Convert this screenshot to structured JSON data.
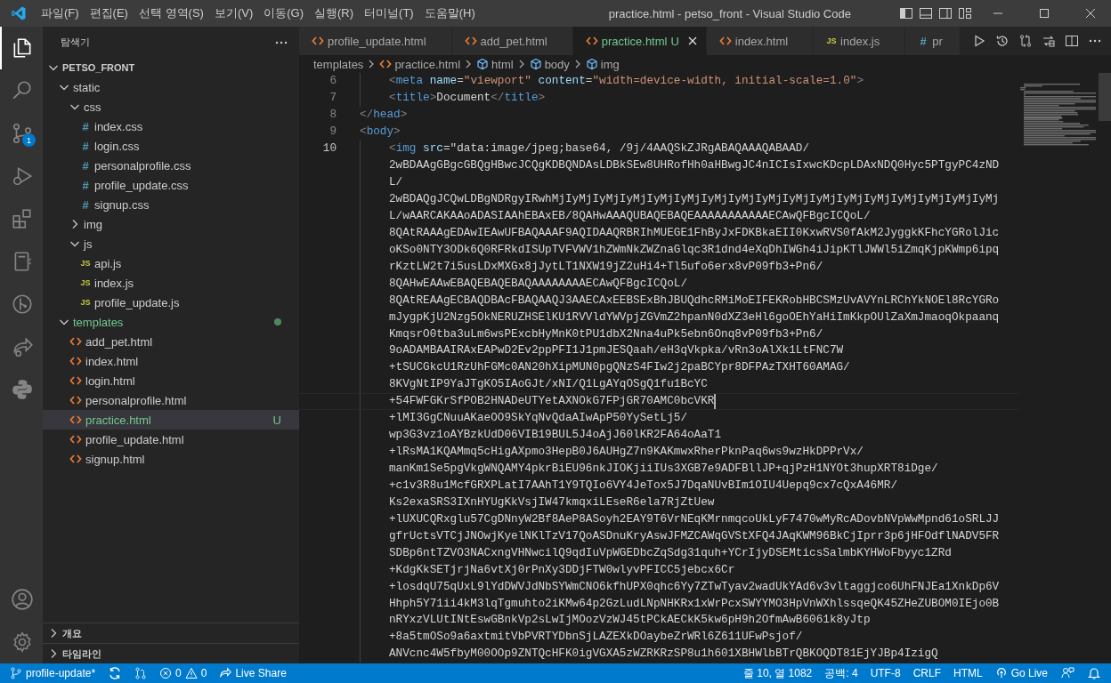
{
  "window": {
    "title": "practice.html - petso_front - Visual Studio Code"
  },
  "menu": [
    "파일(F)",
    "편집(E)",
    "선택 영역(S)",
    "보기(V)",
    "이동(G)",
    "실행(R)",
    "터미널(T)",
    "도움말(H)"
  ],
  "activity_bar": {
    "source_control_badge": "1"
  },
  "sidebar": {
    "title": "탐색기",
    "tree": {
      "label": "PETSO_FRONT",
      "kind": "root",
      "expanded": true,
      "selected": false,
      "untracked": false,
      "children": [
        {
          "label": "static",
          "kind": "folder",
          "expanded": true,
          "selected": false,
          "untracked": false,
          "children": [
            {
              "label": "css",
              "kind": "folder",
              "expanded": true,
              "selected": false,
              "untracked": false,
              "children": [
                {
                  "label": "index.css",
                  "kind": "css",
                  "icon": "#",
                  "selected": false,
                  "untracked": false
                },
                {
                  "label": "login.css",
                  "kind": "css",
                  "icon": "#",
                  "selected": false,
                  "untracked": false
                },
                {
                  "label": "personalprofile.css",
                  "kind": "css",
                  "icon": "#",
                  "selected": false,
                  "untracked": false
                },
                {
                  "label": "profile_update.css",
                  "kind": "css",
                  "icon": "#",
                  "selected": false,
                  "untracked": false
                },
                {
                  "label": "signup.css",
                  "kind": "css",
                  "icon": "#",
                  "selected": false,
                  "untracked": false
                }
              ]
            },
            {
              "label": "img",
              "kind": "folder",
              "expanded": false,
              "selected": false,
              "untracked": false
            },
            {
              "label": "js",
              "kind": "folder",
              "expanded": true,
              "selected": false,
              "untracked": false,
              "children": [
                {
                  "label": "api.js",
                  "kind": "js",
                  "icon": "JS",
                  "selected": false,
                  "untracked": false
                },
                {
                  "label": "index.js",
                  "kind": "js",
                  "icon": "JS",
                  "selected": false,
                  "untracked": false
                },
                {
                  "label": "profile_update.js",
                  "kind": "js",
                  "icon": "JS",
                  "selected": false,
                  "untracked": false
                }
              ]
            }
          ]
        },
        {
          "label": "templates",
          "kind": "folder",
          "expanded": true,
          "selected": false,
          "untracked": true,
          "children": [
            {
              "label": "add_pet.html",
              "kind": "html",
              "selected": false,
              "untracked": false
            },
            {
              "label": "index.html",
              "kind": "html",
              "selected": false,
              "untracked": false
            },
            {
              "label": "login.html",
              "kind": "html",
              "selected": false,
              "untracked": false
            },
            {
              "label": "personalprofile.html",
              "kind": "html",
              "selected": false,
              "untracked": false
            },
            {
              "label": "practice.html",
              "kind": "html",
              "selected": true,
              "untracked": true,
              "status": "U"
            },
            {
              "label": "profile_update.html",
              "kind": "html",
              "selected": false,
              "untracked": false
            },
            {
              "label": "signup.html",
              "kind": "html",
              "selected": false,
              "untracked": false
            }
          ]
        }
      ]
    }
  },
  "sections": [
    {
      "label": "개요",
      "expanded": false
    },
    {
      "label": "타임라인",
      "expanded": false
    }
  ],
  "tabs": [
    {
      "label": "profile_update.html",
      "kind": "html",
      "selected": false,
      "untracked": false
    },
    {
      "label": "add_pet.html",
      "kind": "html",
      "selected": false,
      "untracked": false
    },
    {
      "label": "practice.html",
      "kind": "html",
      "selected": true,
      "untracked": true,
      "status": "U"
    },
    {
      "label": "index.html",
      "kind": "html",
      "selected": false,
      "untracked": false
    },
    {
      "label": "index.js",
      "kind": "js",
      "icon": "JS",
      "selected": false,
      "untracked": false
    },
    {
      "label": "pr",
      "kind": "css",
      "icon": "#",
      "selected": false,
      "untracked": false
    }
  ],
  "breadcrumbs": [
    {
      "label": "templates",
      "kind": "folder"
    },
    {
      "label": "practice.html",
      "kind": "html"
    },
    {
      "label": "html",
      "kind": "element"
    },
    {
      "label": "body",
      "kind": "element"
    },
    {
      "label": "img",
      "kind": "element"
    }
  ],
  "editor": {
    "rows": [
      {
        "kind": "nested",
        "number": "6",
        "current": false,
        "tokens": [
          {
            "kind": "bracket",
            "text": "<"
          },
          {
            "kind": "tag",
            "text": "meta"
          },
          {
            "kind": "attr",
            "text": " name"
          },
          {
            "kind": "text",
            "text": "="
          },
          {
            "kind": "string",
            "text": "\"viewport\""
          },
          {
            "kind": "attr",
            "text": " content"
          },
          {
            "kind": "text",
            "text": "="
          },
          {
            "kind": "string",
            "text": "\"width=device-width, initial-scale=1.0\""
          },
          {
            "kind": "bracket",
            "text": ">"
          }
        ]
      },
      {
        "kind": "nested",
        "number": "7",
        "current": false,
        "tokens": [
          {
            "kind": "bracket",
            "text": "<"
          },
          {
            "kind": "tag",
            "text": "title"
          },
          {
            "kind": "bracket",
            "text": ">"
          },
          {
            "kind": "text",
            "text": "Document"
          },
          {
            "kind": "bracket",
            "text": "</"
          },
          {
            "kind": "tag",
            "text": "title"
          },
          {
            "kind": "bracket",
            "text": ">"
          }
        ]
      },
      {
        "kind": "top",
        "number": "8",
        "current": false,
        "tokens": [
          {
            "kind": "bracket",
            "text": "</"
          },
          {
            "kind": "tag",
            "text": "head"
          },
          {
            "kind": "bracket",
            "text": ">"
          }
        ]
      },
      {
        "kind": "top",
        "number": "9",
        "current": false,
        "tokens": [
          {
            "kind": "bracket",
            "text": "<"
          },
          {
            "kind": "tag",
            "text": "body"
          },
          {
            "kind": "bracket",
            "text": ">"
          }
        ]
      },
      {
        "kind": "nested",
        "number": "10",
        "current": false,
        "tokens": [
          {
            "kind": "bracket",
            "text": "<"
          },
          {
            "kind": "tag",
            "text": "img"
          },
          {
            "kind": "attr",
            "text": " src"
          },
          {
            "kind": "text",
            "text": "=\"data:image/jpeg;base64, /9j/4AAQSkZJRgABAQAAAQABAAD/"
          }
        ]
      },
      {
        "kind": "wrap",
        "current": false,
        "tokens": [
          {
            "kind": "text",
            "text": "2wBDAAgGBgcGBQgHBwcJCQgKDBQNDAsLDBkSEw8UHRofHh0aHBwgJC4nICIsIxwcKDcpLDAxNDQ0Hyc5PTgyPC4zND"
          }
        ]
      },
      {
        "kind": "wrap",
        "current": false,
        "tokens": [
          {
            "kind": "text",
            "text": "L/"
          }
        ]
      },
      {
        "kind": "wrap",
        "current": false,
        "tokens": [
          {
            "kind": "text",
            "text": "2wBDAQgJCQwLDBgNDRgyIRwhMjIyMjIyMjIyMjIyMjIyMjIyMjIyMjIyMjIyMjIyMjIyMjIyMjIyMjIyMjIyMjIyMj"
          }
        ]
      },
      {
        "kind": "wrap",
        "current": false,
        "tokens": [
          {
            "kind": "text",
            "text": "L/wAARCAKAAoADASIAAhEBAxEB/8QAHwAAAQUBAQEBAQEAAAAAAAAAAAECAwQFBgcICQoL/"
          }
        ]
      },
      {
        "kind": "wrap",
        "current": false,
        "tokens": [
          {
            "kind": "text",
            "text": "8QAtRAAAgEDAwIEAwUFBAQAAAF9AQIDAAQRBRIhMUEGE1FhByJxFDKBkaEII0KxwRVS0fAkM2JyggkKFhcYGRolJic"
          }
        ]
      },
      {
        "kind": "wrap",
        "current": false,
        "tokens": [
          {
            "kind": "text",
            "text": "oKSo0NTY3ODk6Q0RFRkdISUpTVFVWV1hZWmNkZWZnaGlqc3R1dnd4eXqDhIWGh4iJipKTlJWWl5iZmqKjpKWmp6ipq"
          }
        ]
      },
      {
        "kind": "wrap",
        "current": false,
        "tokens": [
          {
            "kind": "text",
            "text": "rKztLW2t7i5usLDxMXGx8jJytLT1NXW19jZ2uHi4+Tl5ufo6erx8vP09fb3+Pn6/"
          }
        ]
      },
      {
        "kind": "wrap",
        "current": false,
        "tokens": [
          {
            "kind": "text",
            "text": "8QAHwEAAwEBAQEBAQEBAQAAAAAAAAECAwQFBgcICQoL/"
          }
        ]
      },
      {
        "kind": "wrap",
        "current": false,
        "tokens": [
          {
            "kind": "text",
            "text": "8QAtREAAgECBAQDBAcFBAQAAQJ3AAECAxEEBSExBhJBUQdhcRMiMoEIFEKRobHBCSMzUvAVYnLRChYkNOEl8RcYGRo"
          }
        ]
      },
      {
        "kind": "wrap",
        "current": false,
        "tokens": [
          {
            "kind": "text",
            "text": "mJygpKjU2Nzg5OkNERUZHSElKU1RVVldYWVpjZGVmZ2hpanN0dXZ3eHl6goOEhYaHiImKkpOUlZaXmJmaoqOkpaanq"
          }
        ]
      },
      {
        "kind": "wrap",
        "current": false,
        "tokens": [
          {
            "kind": "text",
            "text": "KmqsrO0tba3uLm6wsPExcbHyMnK0tPU1dbX2Nna4uPk5ebn6Onq8vP09fb3+Pn6/"
          }
        ]
      },
      {
        "kind": "wrap",
        "current": false,
        "tokens": [
          {
            "kind": "text",
            "text": "9oADAMBAAIRAxEAPwD2Ev2ppPFI1J1pmJESQaah/eH3qVkpka/vRn3oAlXk1LtFNC7W"
          }
        ]
      },
      {
        "kind": "wrap",
        "current": false,
        "tokens": [
          {
            "kind": "text",
            "text": "+tSUCGkcU1RzUhFGMc0AN20hXipMUN0pgQNzS4FIw2j2paBCYpr8DFPAzTXHT60AMAG/"
          }
        ]
      },
      {
        "kind": "wrap",
        "current": false,
        "tokens": [
          {
            "kind": "text",
            "text": "8KVgNtIP9YaJTgKO5IAoGJt/xNI/Q1LgAYqOSgQ1fu1BcYC"
          }
        ]
      },
      {
        "kind": "wrap",
        "current": true,
        "tokens": [
          {
            "kind": "text",
            "text": "+54FWFGKrSfPOB2HNADeUTYetAXNOkG7FPjGR70AMC0bcVKR"
          }
        ]
      },
      {
        "kind": "wrap",
        "current": false,
        "tokens": [
          {
            "kind": "text",
            "text": "+lMI3GgCNuuAKaeOO9SkYqNvQdaAIwApP50YySetLj5/"
          }
        ]
      },
      {
        "kind": "wrap",
        "current": false,
        "tokens": [
          {
            "kind": "text",
            "text": "wp3G3vz1oAYBzkUdD06VIB19BUL5J4oAjJ60lKR2FA64oAaT1"
          }
        ]
      },
      {
        "kind": "wrap",
        "current": false,
        "tokens": [
          {
            "kind": "text",
            "text": "+lRsMA1KQAMmq5cHigAXpmo3HepB0J6AUHgZ7n9KAKmwxRherPknPaq6ws9wzHkDPPrVx/"
          }
        ]
      },
      {
        "kind": "wrap",
        "current": false,
        "tokens": [
          {
            "kind": "text",
            "text": "manKm1Se5pgVkgWNQAMY4pkrBiEU96nkJIOKjiiIUs3XGB7e9ADFBllJP+qjPzH1NYOt3hupXRT8iDge/"
          }
        ]
      },
      {
        "kind": "wrap",
        "current": false,
        "tokens": [
          {
            "kind": "text",
            "text": "+c1v3R8u1McfGRXPLatI7AAhT1Y9TQIo6VY4JeTox5J7DqaNUvBIm1OIU4Uepq9cx7cQxA46MR/"
          }
        ]
      },
      {
        "kind": "wrap",
        "current": false,
        "tokens": [
          {
            "kind": "text",
            "text": "Ks2exaSRS3IXnHYUgKkVsjIW47kmqxiLEseR6ela7RjZtUew"
          }
        ]
      },
      {
        "kind": "wrap",
        "current": false,
        "tokens": [
          {
            "kind": "text",
            "text": "+lUXUCQRxglu57CgDNnyW2Bf8AeP8ASoyh2EAY9T6VrNEqKMrnmqcoUkLyF7470wMyRcADovbNVpWwMpnd61oSRLJJ"
          }
        ]
      },
      {
        "kind": "wrap",
        "current": false,
        "tokens": [
          {
            "kind": "text",
            "text": "gfrUctsVTCjJNOwjKyelNKlTzV17QoASDnuKryAswJFMZCAWqGVStXFQ4JAqKWM96BkCjIprr3p6jHFOdflNADV5FR"
          }
        ]
      },
      {
        "kind": "wrap",
        "current": false,
        "tokens": [
          {
            "kind": "text",
            "text": "SDBp6ntTZVO3NACxngVHNwcilQ9qdIuVpWGEDbcZqSdg31quh+YCrIjyDSEMticsSalmbKYHWoFbyyc1ZRd"
          }
        ]
      },
      {
        "kind": "wrap",
        "current": false,
        "tokens": [
          {
            "kind": "text",
            "text": "+KdgKkSETjrjNa6vtXj0rPnXy3DDjFTW0wlyvPFICC5jebcx6Cr"
          }
        ]
      },
      {
        "kind": "wrap",
        "current": false,
        "tokens": [
          {
            "kind": "text",
            "text": "+losdqU75qUxL9lYdDWVJdNbSYWmCNO6kfhUPX0qhc6Yy7ZTwTyav2wadUkYAd6v3vltaggjco6UhFNJEa1XnkDp6V"
          }
        ]
      },
      {
        "kind": "wrap",
        "current": false,
        "tokens": [
          {
            "kind": "text",
            "text": "Hhph5Y71ii4kM3lqTgmuhto2iKMw64p2GzLudLNpNHKRx1xWrPcxSWYYMO3HpVnWXhlssqeQK45ZHeZUBOM0IEjo0B"
          }
        ]
      },
      {
        "kind": "wrap",
        "current": false,
        "tokens": [
          {
            "kind": "text",
            "text": "nRYxzVLUtINtEswGBnkVp2sLwIjMOozVzWJ45tPCkAECkK5kw6pH9h2OfmAwB6061k8yJtp"
          }
        ]
      },
      {
        "kind": "wrap",
        "current": false,
        "tokens": [
          {
            "kind": "text",
            "text": "+8a5tmOSo9a6axtmitVbPVRTYDbnSjLAZEXkDOaybeZrWRl6Z611UFwPsjof/"
          }
        ]
      },
      {
        "kind": "wrap",
        "current": false,
        "tokens": [
          {
            "kind": "text",
            "text": "ANVcnc4W5fbyM00OOp9ZNTQcHFK0igVGXA5zWZRKRzSP8u1h601XBHWlbBTrQBKOQDT81EjYJBp4IzigQ"
          }
        ]
      }
    ]
  },
  "status_bar": {
    "branch": "profile-update*",
    "errors": "0",
    "warnings": "0",
    "live_share": "Live Share",
    "position": "줄 10, 열 1082",
    "indent": "공백: 4",
    "encoding": "UTF-8",
    "eol": "CRLF",
    "language": "HTML",
    "go_live": "Go Live"
  }
}
